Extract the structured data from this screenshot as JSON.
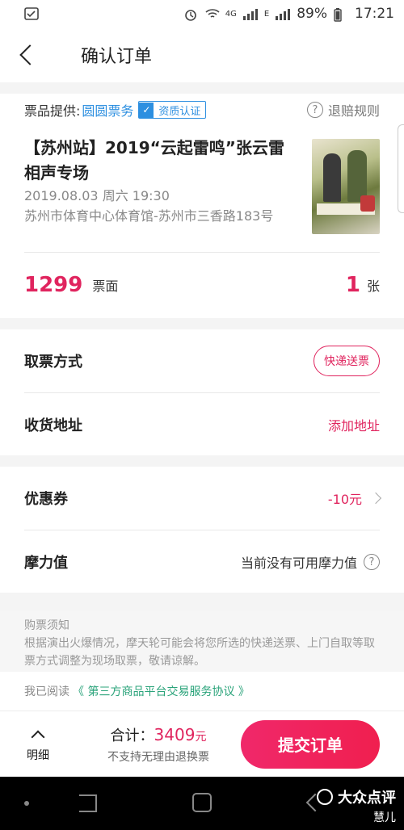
{
  "status_bar": {
    "battery": "89%",
    "time": "17:21",
    "network": "4G",
    "network2": "E"
  },
  "nav": {
    "title": "确认订单"
  },
  "ticket": {
    "provider_label": "票品提供:",
    "provider_name": "圆圆票务",
    "cert_label": "资质认证",
    "refund_rules": "退赔规则",
    "title": "【苏州站】2019“云起雷鸣”张云雷相声专场",
    "date": "2019.08.03 周六 19:30",
    "venue": "苏州市体育中心体育馆-苏州市三香路183号",
    "price": "1299",
    "price_label": "票面",
    "quantity": "1",
    "quantity_unit": "张"
  },
  "delivery": {
    "method_label": "取票方式",
    "method_value": "快递送票",
    "address_label": "收货地址",
    "address_action": "添加地址"
  },
  "discounts": {
    "coupon_label": "优惠券",
    "coupon_value": "-10元",
    "points_label": "摩力值",
    "points_value": "当前没有可用摩力值"
  },
  "notice": {
    "title": "购票须知",
    "text": "根据演出火爆情况，摩天轮可能会将您所选的快递送票、上门自取等取票方式调整为现场取票，敬请谅解。"
  },
  "agreement": {
    "prefix": "我已阅读",
    "link": "《 第三方商品平台交易服务协议 》"
  },
  "footer": {
    "details_label": "明细",
    "total_label": "合计：",
    "total_amount": "3409",
    "total_currency": "元",
    "no_refund": "不支持无理由退换票",
    "submit_label": "提交订单"
  },
  "watermark": {
    "brand": "大众点评",
    "user": "慧儿"
  },
  "colors": {
    "accent": "#e0245e",
    "link_blue": "#2d8fe0",
    "link_green": "#2aa37a"
  }
}
